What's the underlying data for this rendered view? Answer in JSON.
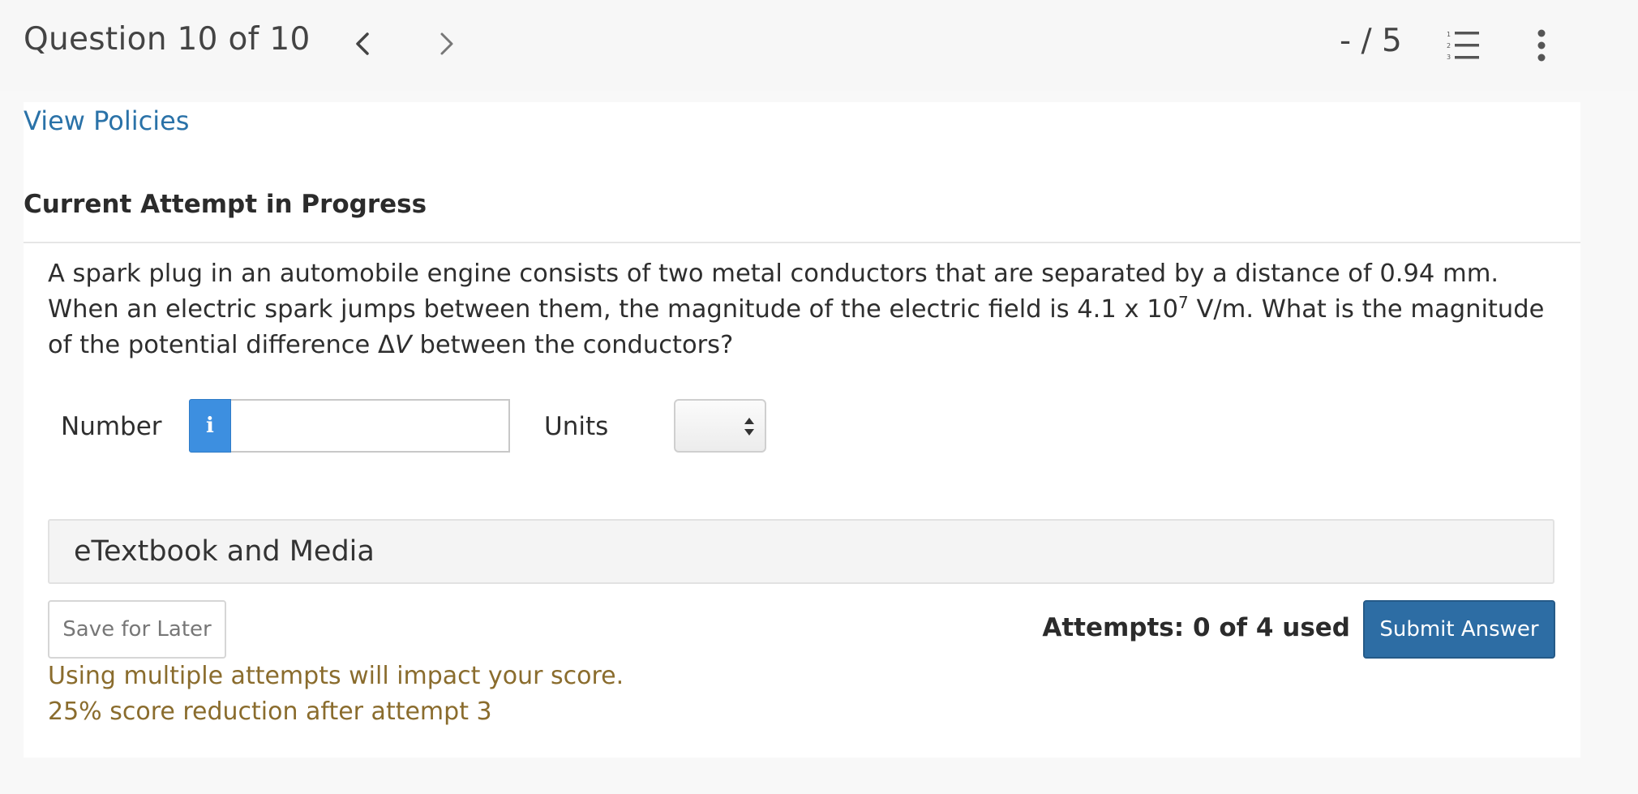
{
  "header": {
    "question_label": "Question 10 of 10",
    "score": "- / 5",
    "prev_icon": "chevron-left-icon",
    "next_icon": "chevron-right-icon",
    "list_icon": "numbered-list-icon",
    "more_icon": "more-vertical-icon"
  },
  "card": {
    "policies_link": "View Policies",
    "attempt_heading": "Current Attempt in Progress",
    "question": {
      "part1": "A spark plug in an automobile engine consists of two metal conductors that are separated by a distance of 0.94 mm. When an electric spark jumps between them, the magnitude of the electric field is 4.1 x 10",
      "exponent": "7",
      "part2": " V/m. What is the magnitude of the potential difference Δ",
      "var": "V",
      "part3": " between the conductors?"
    },
    "answer": {
      "number_label": "Number",
      "info_glyph": "i",
      "number_value": "",
      "units_label": "Units",
      "units_value": ""
    },
    "etextbook_label": "eTextbook and Media",
    "save_label": "Save for Later",
    "attempts_text": "Attempts: 0 of 4 used",
    "submit_label": "Submit Answer",
    "warning_line1": "Using multiple attempts will impact your score.",
    "warning_line2": "25% score reduction after attempt 3"
  },
  "colors": {
    "link": "#2a72a8",
    "primary_button": "#2d6da4",
    "info_button": "#3d8fe0",
    "warning_text": "#8a6c2d"
  }
}
